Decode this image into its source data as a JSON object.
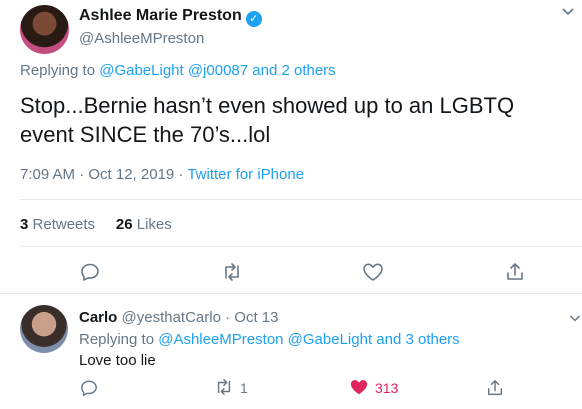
{
  "tweet": {
    "author_name": "Ashlee Marie Preston",
    "author_handle": "@AshleeMPreston",
    "replying_prefix": "Replying to",
    "replying_mentions": "@GabeLight @j00087 and 2 others",
    "text": "Stop...Bernie hasn’t even showed up to an LGBTQ event SINCE the 70’s...lol",
    "time_date": "7:09 AM · Oct 12, 2019 ·",
    "source": "Twitter for iPhone",
    "retweets_count": "3",
    "retweets_label": "Retweets",
    "likes_count": "26",
    "likes_label": "Likes"
  },
  "reply": {
    "author_name": "Carlo",
    "author_handle": "@yesthatCarlo",
    "date": "· Oct 13",
    "replying_prefix": "Replying to",
    "replying_mentions": "@AshleeMPreston @GabeLight and 3 others",
    "text": "Love too lie",
    "retweet_count": "1",
    "like_count": "313"
  },
  "colors": {
    "link": "#1da1f2",
    "muted": "#657786",
    "like_active": "#e0245e"
  }
}
